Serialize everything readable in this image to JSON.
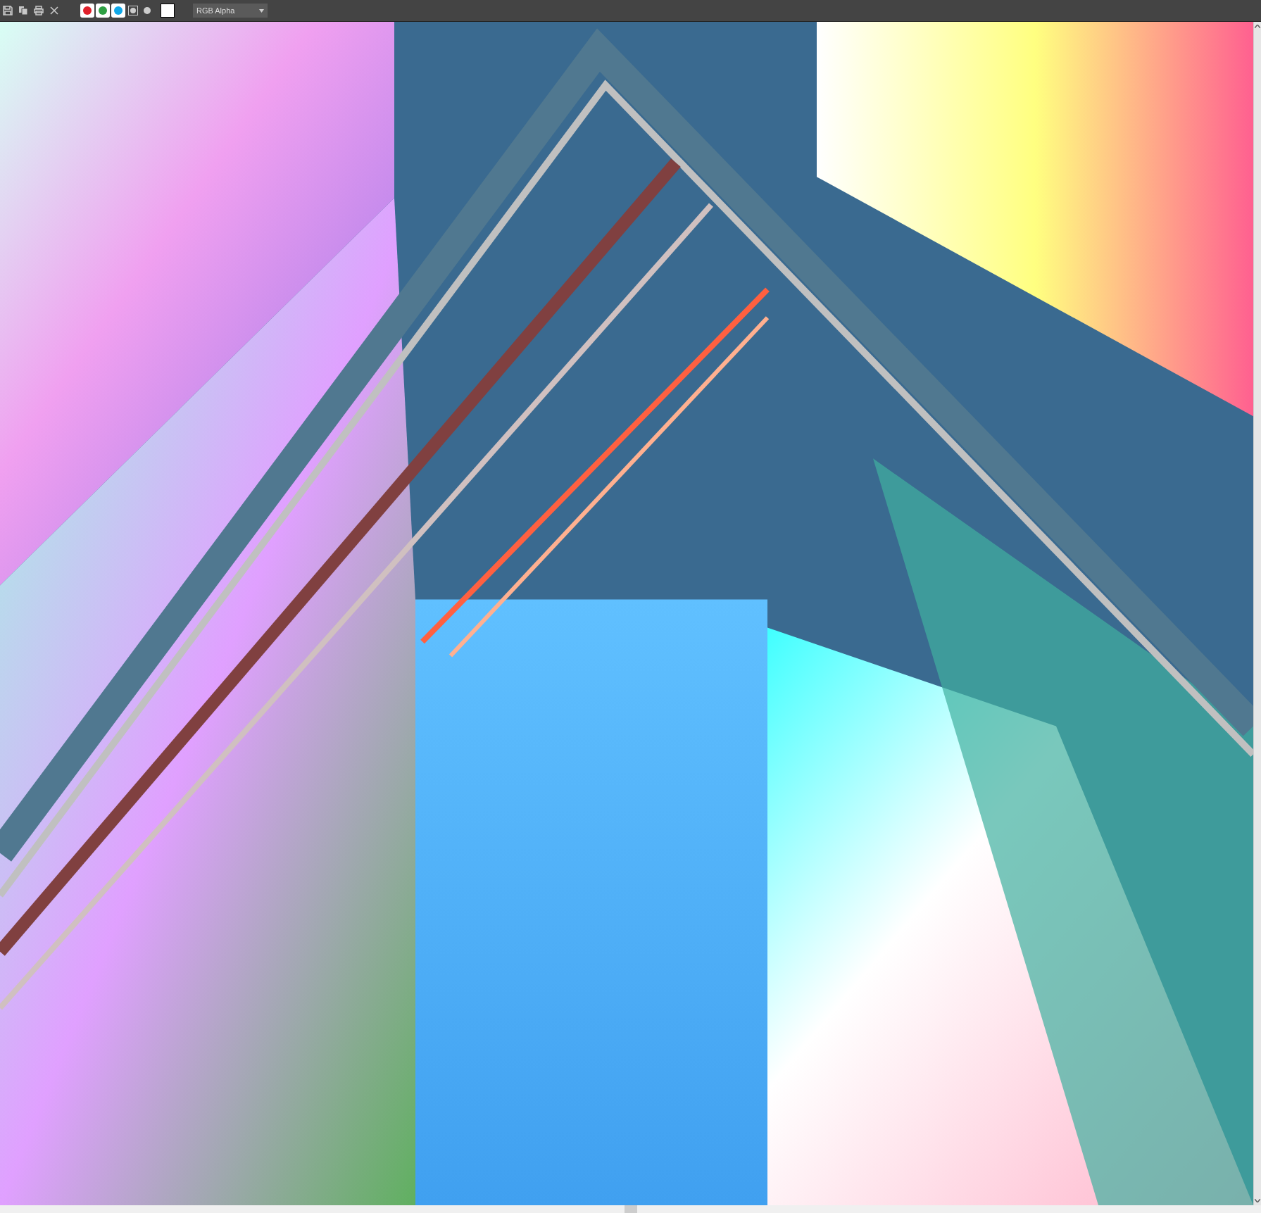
{
  "toolbar": {
    "channels": [
      {
        "kind": "color",
        "color": "#e0202a",
        "selected": true
      },
      {
        "kind": "color",
        "color": "#2ea043",
        "selected": true
      },
      {
        "kind": "color",
        "color": "#10a8e8",
        "selected": true
      },
      {
        "kind": "alpha",
        "selected": false
      },
      {
        "kind": "mono",
        "selected": false
      }
    ],
    "display_channel": {
      "value": "RGB Alpha"
    }
  }
}
